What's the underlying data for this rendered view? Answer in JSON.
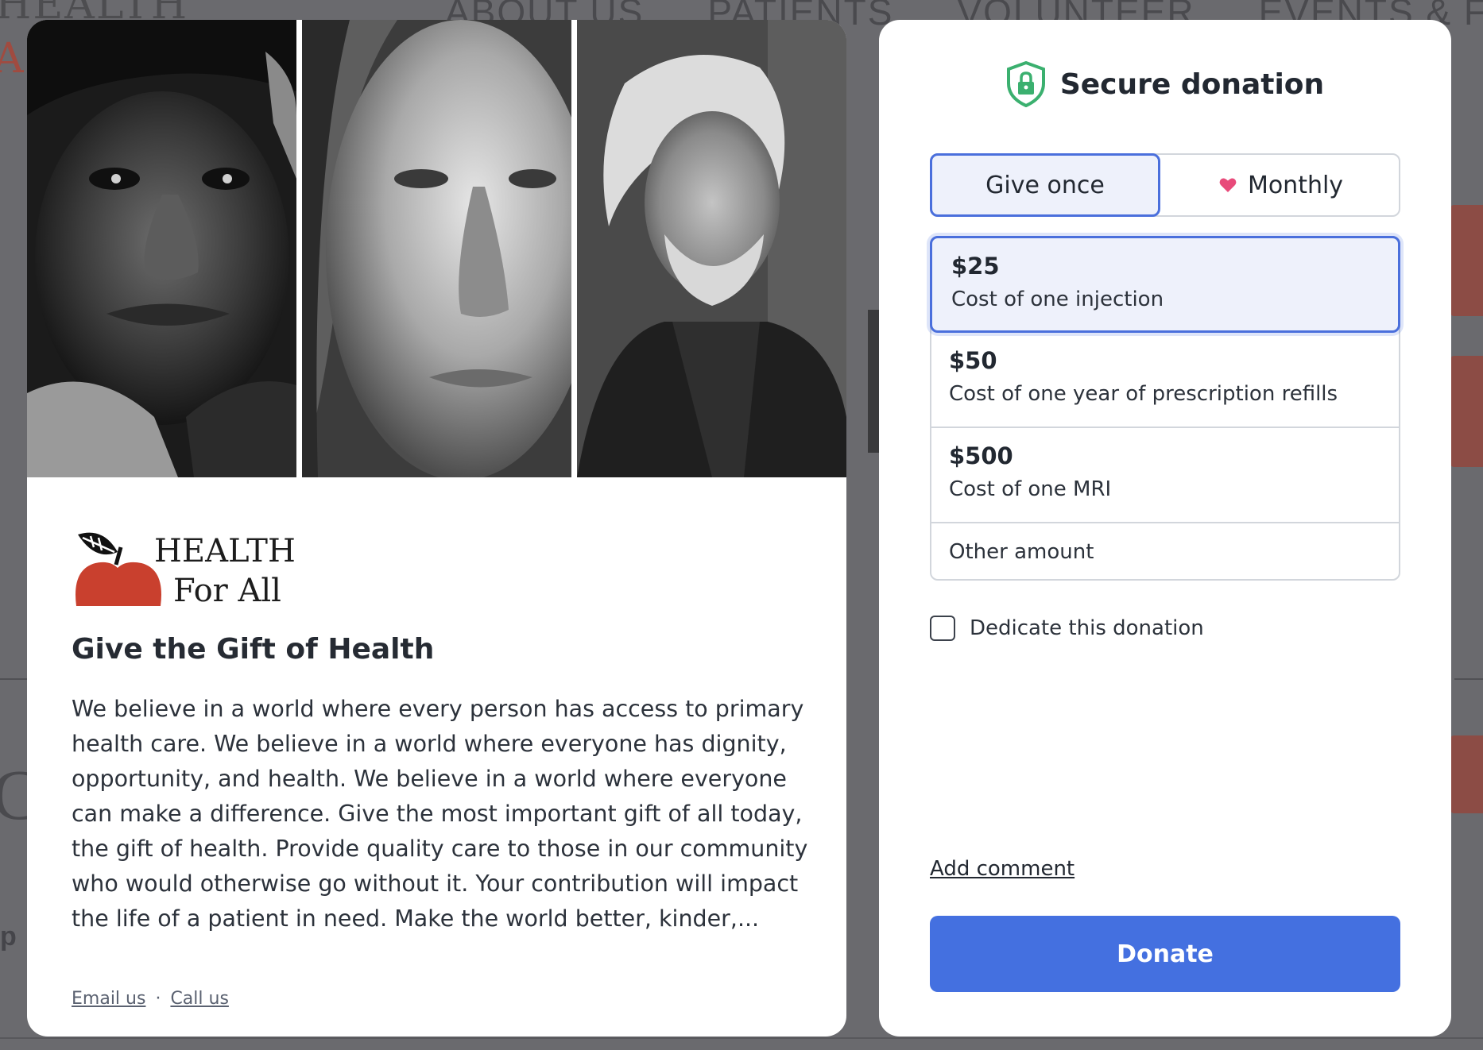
{
  "background_page": {
    "logo_text": "HEALTH",
    "nav_items": [
      "ABOUT US",
      "PATIENTS",
      "VOLUNTEER",
      "EVENTS & FUNDRA"
    ]
  },
  "campaign": {
    "photos": [
      "portrait-man-cap",
      "portrait-woman",
      "portrait-old-man"
    ],
    "org_name_line1": "HEALTH",
    "org_name_line2": "For All",
    "title": "Give the Gift of Health",
    "description": "We believe in a world where every person has access to primary health care. We believe in a world where everyone has dignity, opportunity, and health. We believe in a world where everyone can make a difference. Give the most important gift of all today, the gift of health. Provide quality care to those in our community who would otherwise go without it. Your contribution will impact the life of a patient in need. Make the world better, kinder,...",
    "links": {
      "email": "Email us",
      "separator": "·",
      "call": "Call us"
    }
  },
  "donation_form": {
    "header": "Secure donation",
    "frequency": {
      "once_label": "Give once",
      "monthly_label": "Monthly",
      "selected": "once"
    },
    "amounts": [
      {
        "amount": "$25",
        "description": "Cost of one injection",
        "selected": true
      },
      {
        "amount": "$50",
        "description": "Cost of one year of prescription refills",
        "selected": false
      },
      {
        "amount": "$500",
        "description": "Cost of one MRI",
        "selected": false
      }
    ],
    "other_amount_label": "Other amount",
    "dedicate_label": "Dedicate this donation",
    "dedicate_checked": false,
    "add_comment_label": "Add comment",
    "donate_label": "Donate"
  },
  "colors": {
    "accent_blue": "#4470e0",
    "selected_bg": "#eef1fb",
    "shield_green": "#3bb06f",
    "heart_pink": "#e84a7a",
    "logo_red": "#c9402e"
  }
}
